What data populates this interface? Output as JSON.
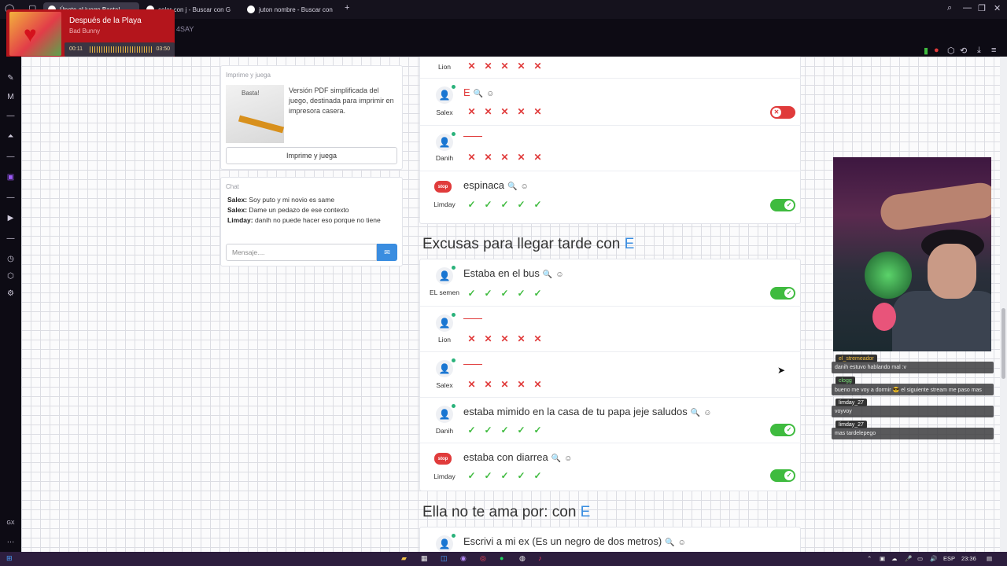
{
  "browser": {
    "tabs": [
      {
        "label": "Únete al juego Basta!",
        "active": true
      },
      {
        "label": "color con j - Buscar con G"
      },
      {
        "label": "juton nombre - Buscar con"
      }
    ],
    "new_tab": "+",
    "url_fragment": "4SAY"
  },
  "media": {
    "title": "Después de la Playa",
    "artist": "Bad Bunny",
    "elapsed": "00:11",
    "duration": "03:50",
    "progress": 0.05
  },
  "print_card": {
    "title": "Imprime y juega",
    "description": "Versión PDF simplificada del juego, destinada para imprimir en impresora casera.",
    "button": "Imprime y juega",
    "image_label": "Basta!"
  },
  "chat": {
    "title": "Chat",
    "messages": [
      {
        "user": "Salex:",
        "text": "Soy puto y mi novio es same"
      },
      {
        "user": "Salex:",
        "text": "Dame un pedazo de ese contexto"
      },
      {
        "user": "Limday:",
        "text": "danih no puede hacer eso porque no tiene"
      }
    ],
    "input_placeholder": "Mensaje...."
  },
  "top_block": {
    "rows": [
      {
        "player": "Lion",
        "answer": "",
        "marks": [
          "x",
          "x",
          "x",
          "x",
          "x"
        ],
        "toggle": null
      },
      {
        "player": "Salex",
        "answer": "E",
        "marks": [
          "x",
          "x",
          "x",
          "x",
          "x"
        ],
        "toggle": "off"
      },
      {
        "player": "Danih",
        "answer": "",
        "marks": [
          "x",
          "x",
          "x",
          "x",
          "x"
        ],
        "toggle": null
      },
      {
        "player": "Limday",
        "answer": "espinaca",
        "marks": [
          "ok",
          "ok",
          "ok",
          "ok",
          "ok"
        ],
        "toggle": "on"
      }
    ]
  },
  "section1": {
    "title": "Excusas para llegar tarde con",
    "letter": "E",
    "rows": [
      {
        "player": "EL semen",
        "answer": "Estaba en el bus",
        "marks": [
          "ok",
          "ok",
          "ok",
          "ok",
          "ok"
        ],
        "toggle": "on"
      },
      {
        "player": "Lion",
        "answer": "",
        "marks": [
          "x",
          "x",
          "x",
          "x",
          "x"
        ],
        "toggle": null
      },
      {
        "player": "Salex",
        "answer": "",
        "marks": [
          "x",
          "x",
          "x",
          "x",
          "x"
        ],
        "toggle": null
      },
      {
        "player": "Danih",
        "answer": "estaba mimido en la casa de tu papa jeje saludos",
        "marks": [
          "ok",
          "ok",
          "ok",
          "ok",
          "ok"
        ],
        "toggle": "on"
      },
      {
        "player": "Limday",
        "answer": "estaba con diarrea",
        "marks": [
          "ok",
          "ok",
          "ok",
          "ok",
          "ok"
        ],
        "toggle": "on"
      }
    ]
  },
  "section2": {
    "title": "Ella no te ama por: con",
    "letter": "E",
    "first_answer": "Escrivi a mi ex (Es un negro de dos metros)"
  },
  "stop_label": "stop",
  "stream_chat": [
    {
      "user": "el_stremeador",
      "text": "danih estuvo hablando mal :v"
    },
    {
      "user": "clogg",
      "text": "bueno me voy a dormir 😎 el siguiente stream me paso mas"
    },
    {
      "user": "limday_27",
      "text": "voyvoy"
    },
    {
      "user": "limday_27",
      "text": "mas tardelepego"
    }
  ],
  "taskbar": {
    "lang": "ESP",
    "time": "23:36"
  },
  "colors": {
    "accent": "#3a8de0",
    "error": "#e03b3b",
    "success": "#3fbb3f",
    "media": "#b4151c"
  }
}
